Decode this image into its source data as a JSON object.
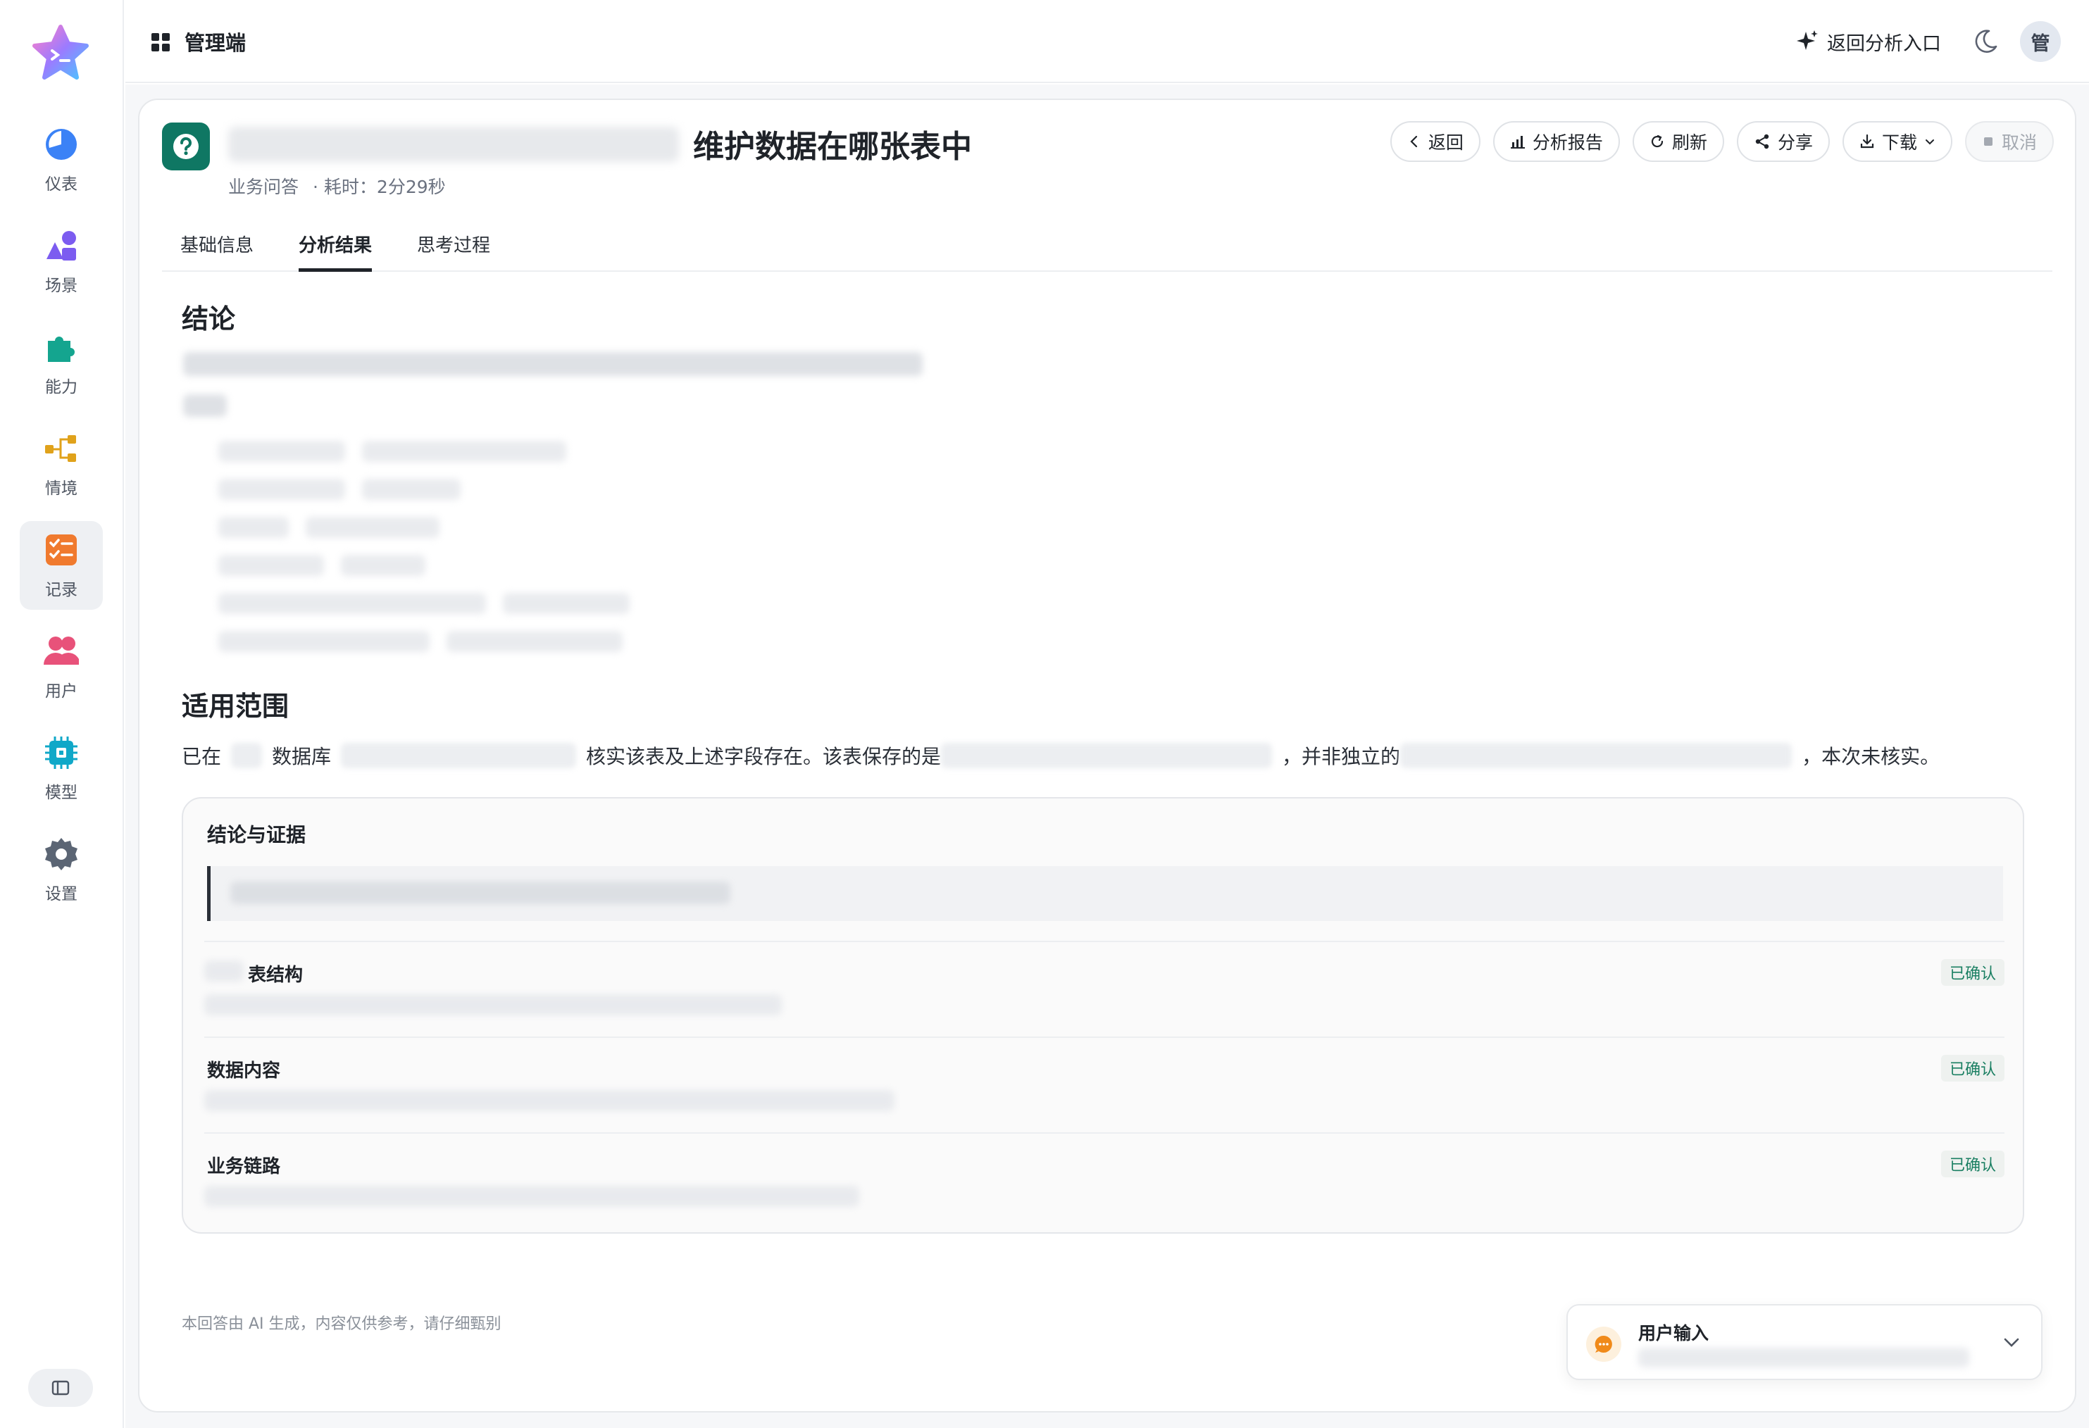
{
  "sidebar": {
    "items": [
      {
        "label": "仪表",
        "icon": "dashboard-pie-icon",
        "color": "#3b82f6"
      },
      {
        "label": "场景",
        "icon": "shapes-icon",
        "color": "#7c5cf0"
      },
      {
        "label": "能力",
        "icon": "puzzle-icon",
        "color": "#14a58f"
      },
      {
        "label": "情境",
        "icon": "flow-nodes-icon",
        "color": "#e0a21b"
      },
      {
        "label": "记录",
        "icon": "checklist-icon",
        "color": "#f07a2e",
        "active": true
      },
      {
        "label": "用户",
        "icon": "users-icon",
        "color": "#e8527a"
      },
      {
        "label": "模型",
        "icon": "chip-icon",
        "color": "#10a8c8"
      },
      {
        "label": "设置",
        "icon": "gear-icon",
        "color": "#5b6574"
      }
    ]
  },
  "header": {
    "app_title": "管理端",
    "return_entry": "返回分析入口",
    "avatar_text": "管"
  },
  "question": {
    "title_visible": "维护数据在哪张表中",
    "type": "业务问答",
    "elapsed": "· 耗时：2分29秒"
  },
  "toolbar": {
    "back": "返回",
    "report": "分析报告",
    "refresh": "刷新",
    "share": "分享",
    "download": "下载",
    "cancel": "取消"
  },
  "tabs": [
    {
      "label": "基础信息",
      "active": false
    },
    {
      "label": "分析结果",
      "active": true
    },
    {
      "label": "思考过程",
      "active": false
    }
  ],
  "conclusion": {
    "heading": "结论"
  },
  "scope": {
    "heading": "适用范围",
    "text_1": "已在",
    "text_2": "数据库",
    "text_3": "核实该表及上述字段存在。该表保存的是",
    "text_4": "，并非独立的",
    "text_5": "，本次未核实。"
  },
  "evidence": {
    "title": "结论与证据",
    "rows": [
      {
        "label": "表结构",
        "status": "已确认"
      },
      {
        "label": "数据内容",
        "status": "已确认"
      },
      {
        "label": "业务链路",
        "status": "已确认"
      }
    ]
  },
  "footer_note": "本回答由 AI 生成，内容仅供参考，请仔细甄别",
  "user_input": {
    "title": "用户输入"
  },
  "colors": {
    "accent_teal": "#0f7763",
    "confirm_green": "#1a7f62"
  }
}
